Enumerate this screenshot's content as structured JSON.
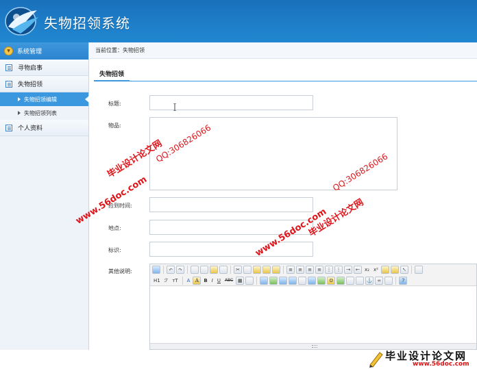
{
  "app": {
    "title": "失物招领系统"
  },
  "sidebar": {
    "header": "系统管理",
    "groups": [
      {
        "label": "寻物启事"
      },
      {
        "label": "失物招领"
      },
      {
        "label": "个人资料"
      }
    ],
    "subitems": [
      {
        "label": "失物招领编辑",
        "active": true
      },
      {
        "label": "失物招领列表",
        "active": false
      }
    ]
  },
  "breadcrumb": {
    "prefix": "当前位置：",
    "current": "失物招领"
  },
  "tab": {
    "label": "失物招领"
  },
  "form": {
    "title_label": "标题:",
    "item_label": "物品:",
    "time_label": "捡到时间:",
    "place_label": "地点:",
    "mark_label": "标识:",
    "other_label": "其他说明:",
    "title_value": "",
    "item_value": "",
    "time_value": "",
    "place_value": "",
    "mark_value": ""
  },
  "editor": {
    "heading_btn": "H1",
    "font_btn": "ℱ",
    "size_btn": "тT",
    "color_btn": "A",
    "bg_btn": "A",
    "bold": "B",
    "italic": "I",
    "underline": "U",
    "strike": "ABC",
    "superscript": "x²",
    "subscript": "x₂"
  },
  "watermarks": {
    "site": "www.56doc.com",
    "qq": "QQ:306826066",
    "name": "毕业设计论文网",
    "brand": "毕业设计论文网",
    "brand_url": "www.56doc.com"
  },
  "colors": {
    "header": "#1d7cc7",
    "accent": "#3b98de",
    "watermark": "#e0151b"
  }
}
